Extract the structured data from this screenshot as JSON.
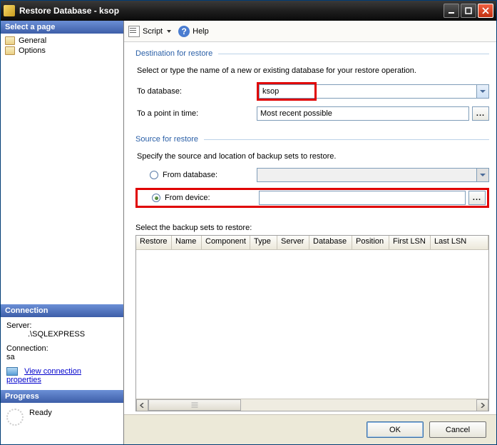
{
  "titlebar": {
    "title": "Restore Database - ksop"
  },
  "sidebar": {
    "selectPageHeader": "Select a page",
    "items": [
      {
        "label": "General"
      },
      {
        "label": "Options"
      }
    ],
    "connectionHeader": "Connection",
    "serverLabel": "Server:",
    "serverValue": ".\\SQLEXPRESS",
    "connLabel": "Connection:",
    "connValue": "sa",
    "viewPropsLabel": "View connection properties",
    "progressHeader": "Progress",
    "progressStatus": "Ready"
  },
  "toolbar": {
    "scriptLabel": "Script",
    "helpLabel": "Help"
  },
  "dest": {
    "title": "Destination for restore",
    "note": "Select or type the name of a new or existing database for your restore operation.",
    "toDbLabel": "To database:",
    "toDbValue": "ksop",
    "toPitLabel": "To a point in time:",
    "toPitValue": "Most recent possible"
  },
  "source": {
    "title": "Source for restore",
    "note": "Specify the source and location of backup sets to restore.",
    "fromDbLabel": "From database:",
    "fromDbValue": "",
    "fromDevLabel": "From device:",
    "fromDevValue": ""
  },
  "backup": {
    "selectLabel": "Select the backup sets to restore:",
    "columns": [
      "Restore",
      "Name",
      "Component",
      "Type",
      "Server",
      "Database",
      "Position",
      "First LSN",
      "Last LSN"
    ],
    "rows": []
  },
  "footer": {
    "ok": "OK",
    "cancel": "Cancel"
  },
  "icons": {
    "ellipsis": "..."
  }
}
